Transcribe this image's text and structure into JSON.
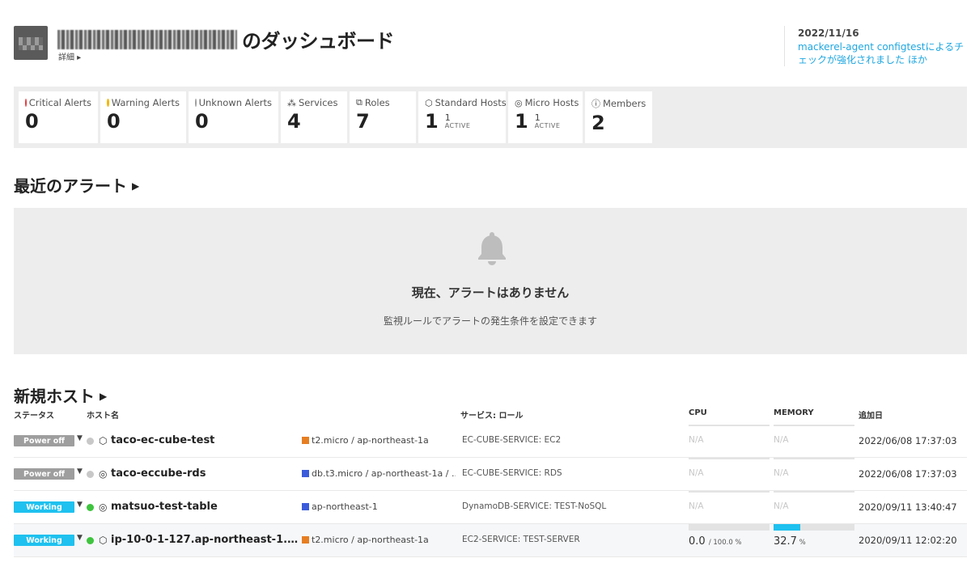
{
  "header": {
    "title_suffix": "のダッシュボード",
    "detail_link": "詳細 ▸"
  },
  "news": {
    "date": "2022/11/16",
    "text": "mackerel-agent configtestによるチェックが強化されました ほか"
  },
  "summary": [
    {
      "label": "Critical Alerts",
      "value": "0",
      "icon": "red-dot",
      "color": "#e8363a"
    },
    {
      "label": "Warning Alerts",
      "value": "0",
      "icon": "yellow-dot",
      "color": "#f2b500"
    },
    {
      "label": "Unknown Alerts",
      "value": "0",
      "icon": "gray-dot",
      "color": "#9e9e9e"
    },
    {
      "label": "Services",
      "value": "4",
      "icon": "services-icon"
    },
    {
      "label": "Roles",
      "value": "7",
      "icon": "roles-icon"
    },
    {
      "label": "Standard Hosts",
      "value": "1",
      "sub_value": "1",
      "sub_label": "ACTIVE",
      "icon": "standard-host-icon"
    },
    {
      "label": "Micro Hosts",
      "value": "1",
      "sub_value": "1",
      "sub_label": "ACTIVE",
      "icon": "micro-host-icon"
    },
    {
      "label": "Members",
      "value": "2",
      "icon": "members-icon"
    }
  ],
  "alerts": {
    "heading": "最近のアラート",
    "empty_title": "現在、アラートはありません",
    "empty_hint": "監視ルールでアラートの発生条件を設定できます"
  },
  "hosts": {
    "heading": "新規ホスト",
    "columns": {
      "status": "ステータス",
      "name": "ホスト名",
      "service_role": "サービス: ロール",
      "cpu": "CPU",
      "memory": "MEMORY",
      "added": "追加日"
    },
    "rows": [
      {
        "status": "Power off",
        "status_kind": "off",
        "dot_color": "#c8c8c8",
        "host_icon": "standard-host-icon",
        "name": "taco-ec-cube-test",
        "type_color": "#e67e22",
        "instance": "t2.micro / ap-northeast-1a",
        "service_role": "EC-CUBE-SERVICE: EC2",
        "cpu": "N/A",
        "memory": "N/A",
        "added": "2022/06/08 17:37:03"
      },
      {
        "status": "Power off",
        "status_kind": "off",
        "dot_color": "#c8c8c8",
        "host_icon": "micro-host-icon",
        "name": "taco-eccube-rds",
        "type_color": "#3b5bdb",
        "instance": "db.t3.micro / ap-northeast-1a / ...",
        "service_role": "EC-CUBE-SERVICE: RDS",
        "cpu": "N/A",
        "memory": "N/A",
        "added": "2022/06/08 17:37:03"
      },
      {
        "status": "Working",
        "status_kind": "on",
        "dot_color": "#3ec43e",
        "host_icon": "micro-host-icon",
        "name": "matsuo-test-table",
        "type_color": "#3b5bdb",
        "instance": "ap-northeast-1",
        "service_role": "DynamoDB-SERVICE: TEST-NoSQL",
        "cpu": "N/A",
        "memory": "N/A",
        "added": "2020/09/11 13:40:47"
      },
      {
        "status": "Working",
        "status_kind": "on",
        "dot_color": "#3ec43e",
        "host_icon": "standard-host-icon",
        "name": "ip-10-0-1-127.ap-northeast-1.compu...",
        "type_color": "#e67e22",
        "instance": "t2.micro / ap-northeast-1a",
        "service_role": "EC2-SERVICE: TEST-SERVER",
        "cpu_value": "0.0",
        "cpu_max": "/ 100.0 %",
        "cpu_pct": 0,
        "memory_value": "32.7",
        "memory_unit": " %",
        "memory_pct": 32.7,
        "added": "2020/09/11 12:02:20"
      }
    ]
  }
}
